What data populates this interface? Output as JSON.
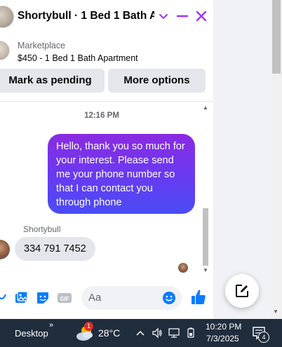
{
  "colors": {
    "messenger_purple": "#8a2be2",
    "messenger_blue": "#0a7cff",
    "bubble_gray": "#e4e6eb",
    "taskbar_bg": "#1f2d3d"
  },
  "header": {
    "title": "Shortybull · 1 Bed 1 Bath A...",
    "chevron_icon": "chevron-down-icon",
    "minimize_icon": "minimize-icon",
    "close_icon": "close-icon"
  },
  "listing": {
    "label": "Marketplace",
    "title": "$450 - 1 Bed 1 Bath Apartment",
    "buttons": {
      "mark_pending": "Mark as pending",
      "more_options": "More options"
    }
  },
  "messages": {
    "timestamp": "12:16 PM",
    "outgoing": [
      {
        "text": "Hello, thank you so much for your interest. Please send me your phone number so that I can contact you through phone"
      }
    ],
    "incoming": [
      {
        "sender": "Shortybull",
        "text": "334 791 7452"
      }
    ]
  },
  "composer": {
    "placeholder": "Aa",
    "icons": [
      "mic-icon",
      "photo-icon",
      "sticker-icon",
      "gif-icon",
      "emoji-icon",
      "thumbs-up-icon"
    ]
  },
  "taskbar": {
    "desktop_label": "Desktop",
    "chevron": "»",
    "weather_badge": "1",
    "temperature": "28°C",
    "time": "10:20 PM",
    "date": "7/3/2025",
    "notification_count": "4"
  }
}
